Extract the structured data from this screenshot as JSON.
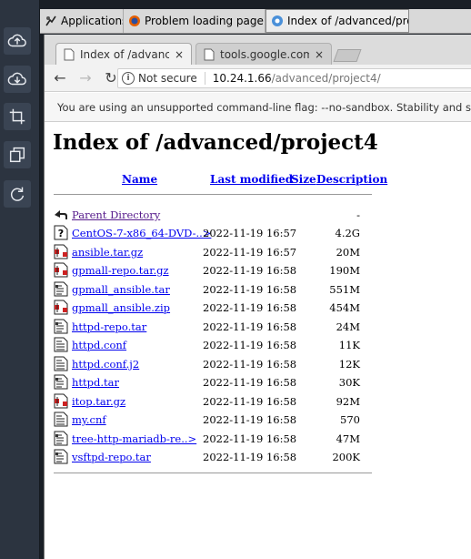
{
  "taskbar": {
    "applications": "Applications",
    "firefox_task": "Problem loading page - ...",
    "chrome_task": "Index of /advanced/proje..."
  },
  "browser": {
    "tabs": [
      {
        "label": "Index of /advanced/p",
        "close": "×"
      },
      {
        "label": "tools.google.com",
        "close": "×"
      }
    ],
    "address": {
      "security": "Not secure",
      "host": "10.24.1.66",
      "path": "/advanced/project4/"
    },
    "infobar": "You are using an unsupported command-line flag: --no-sandbox. Stability and secu"
  },
  "page": {
    "title": "Index of /advanced/project4",
    "columns": {
      "name": "Name",
      "modified": "Last modified",
      "size": "Size",
      "description": "Description"
    },
    "parent": {
      "name": "Parent Directory",
      "size": "-"
    },
    "files": [
      {
        "name": "CentOS-7-x86_64-DVD-..>",
        "date": "2022-11-19 16:57",
        "size": "4.2G",
        "icon": "unknown-file-icon"
      },
      {
        "name": "ansible.tar.gz",
        "date": "2022-11-19 16:57",
        "size": "20M",
        "icon": "compressed-file-icon"
      },
      {
        "name": "gpmall-repo.tar.gz",
        "date": "2022-11-19 16:58",
        "size": "190M",
        "icon": "compressed-file-icon"
      },
      {
        "name": "gpmall_ansible.tar",
        "date": "2022-11-19 16:58",
        "size": "551M",
        "icon": "binary-file-icon"
      },
      {
        "name": "gpmall_ansible.zip",
        "date": "2022-11-19 16:58",
        "size": "454M",
        "icon": "compressed-file-icon"
      },
      {
        "name": "httpd-repo.tar",
        "date": "2022-11-19 16:58",
        "size": "24M",
        "icon": "binary-file-icon"
      },
      {
        "name": "httpd.conf",
        "date": "2022-11-19 16:58",
        "size": "11K",
        "icon": "text-file-icon"
      },
      {
        "name": "httpd.conf.j2",
        "date": "2022-11-19 16:58",
        "size": "12K",
        "icon": "text-file-icon"
      },
      {
        "name": "httpd.tar",
        "date": "2022-11-19 16:58",
        "size": "30K",
        "icon": "binary-file-icon"
      },
      {
        "name": "itop.tar.gz",
        "date": "2022-11-19 16:58",
        "size": "92M",
        "icon": "compressed-file-icon"
      },
      {
        "name": "my.cnf",
        "date": "2022-11-19 16:58",
        "size": "570",
        "icon": "text-file-icon"
      },
      {
        "name": "tree-http-mariadb-re..>",
        "date": "2022-11-19 16:58",
        "size": "47M",
        "icon": "binary-file-icon"
      },
      {
        "name": "vsftpd-repo.tar",
        "date": "2022-11-19 16:58",
        "size": "200K",
        "icon": "binary-file-icon"
      }
    ]
  }
}
